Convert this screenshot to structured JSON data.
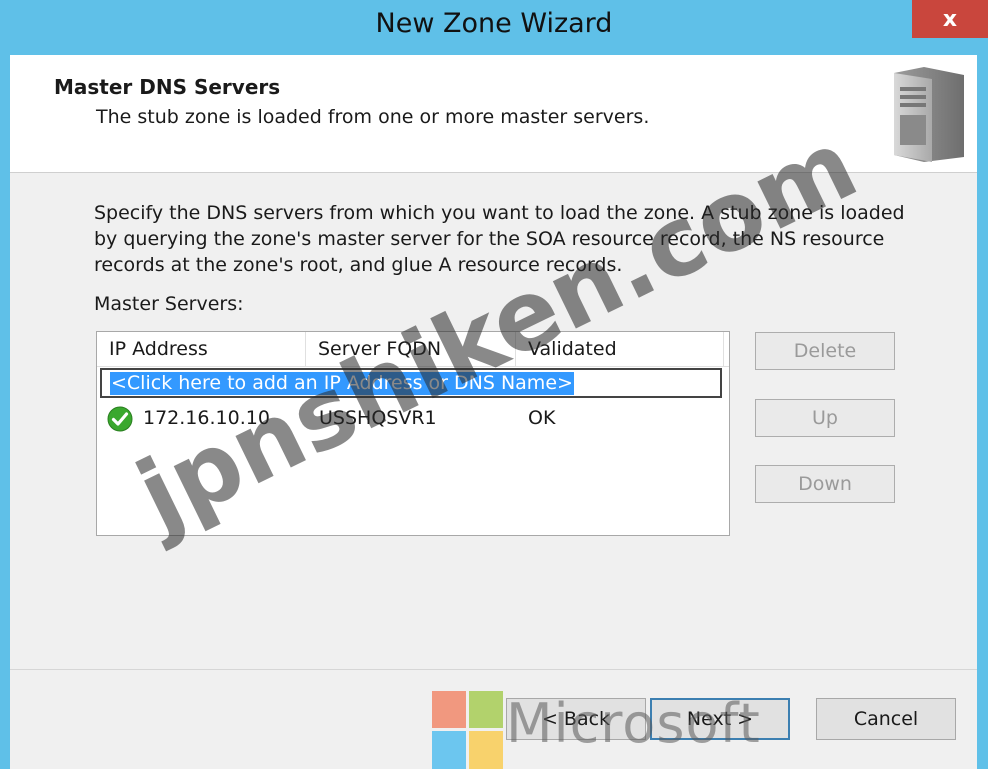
{
  "window": {
    "title": "New Zone Wizard",
    "close_label": "x"
  },
  "header": {
    "title": "Master DNS Servers",
    "subtitle": "The stub zone is loaded from one or more master servers."
  },
  "instructions": "Specify the DNS servers from which you want to load the zone. A stub zone is loaded by querying the zone's master server for the SOA resource record, the NS resource records at the zone's root, and glue A resource records.",
  "master_servers": {
    "label": "Master Servers:",
    "columns": [
      "IP Address",
      "Server FQDN",
      "Validated"
    ],
    "add_prompt": "<Click here to add an IP Address or DNS Name>",
    "rows": [
      {
        "ip": "172.16.10.10",
        "fqdn": "USSHQSVR1",
        "validated": "OK",
        "status_icon": "green-check-icon"
      }
    ]
  },
  "side_buttons": {
    "delete": "Delete",
    "up": "Up",
    "down": "Down"
  },
  "footer": {
    "back": "< Back",
    "next": "Next >",
    "cancel": "Cancel"
  },
  "watermark": {
    "text": "jpnshiken.com",
    "brand": "Microsoft"
  },
  "colors": {
    "titlebar": "#5fc0e8",
    "close": "#c9463d",
    "selection": "#3399ff",
    "ok_green": "#3aa82e"
  }
}
